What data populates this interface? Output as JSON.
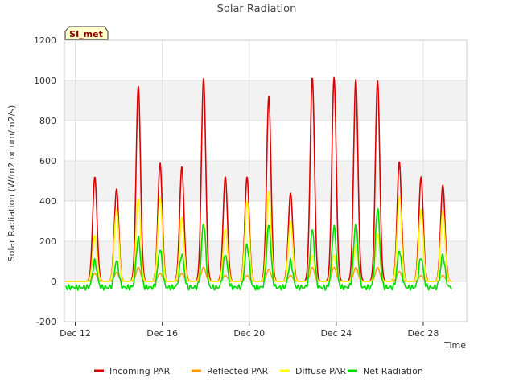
{
  "chart_data": {
    "type": "line",
    "title": "Solar Radiation",
    "xlabel": "Time",
    "ylabel": "Solar Radiation (W/m2 or um/m2/s)",
    "site_badge": "SI_met",
    "xlim": [
      0,
      18
    ],
    "ylim": [
      -200,
      1200
    ],
    "y_ticks": [
      -200,
      0,
      200,
      400,
      600,
      800,
      1000,
      1200
    ],
    "x_ticks": [
      {
        "value": 0,
        "label": "Dec 12"
      },
      {
        "value": 4,
        "label": "Dec 16"
      },
      {
        "value": 8,
        "label": "Dec 20"
      },
      {
        "value": 12,
        "label": "Dec 24"
      },
      {
        "value": 16,
        "label": "Dec 28"
      }
    ],
    "grid": true,
    "banded_background": true,
    "legend_position": "bottom",
    "series": [
      {
        "name": "Incoming PAR",
        "color": "#dd0000"
      },
      {
        "name": "Reflected PAR",
        "color": "#ff9900"
      },
      {
        "name": "Diffuse PAR",
        "color": "#ffff00"
      },
      {
        "name": "Net Radiation",
        "color": "#00dd00"
      }
    ],
    "daily_peaks": [
      {
        "day_center": 0.9,
        "incoming": 520,
        "reflected": 40,
        "diffuse": 230,
        "net": 100
      },
      {
        "day_center": 1.9,
        "incoming": 460,
        "reflected": 45,
        "diffuse": 360,
        "net": 100
      },
      {
        "day_center": 2.9,
        "incoming": 970,
        "reflected": 70,
        "diffuse": 410,
        "net": 215
      },
      {
        "day_center": 3.9,
        "incoming": 590,
        "reflected": 40,
        "diffuse": 420,
        "net": 160
      },
      {
        "day_center": 4.9,
        "incoming": 570,
        "reflected": 40,
        "diffuse": 320,
        "net": 135
      },
      {
        "day_center": 5.9,
        "incoming": 1010,
        "reflected": 70,
        "diffuse": 290,
        "net": 290
      },
      {
        "day_center": 6.9,
        "incoming": 520,
        "reflected": 30,
        "diffuse": 260,
        "net": 135
      },
      {
        "day_center": 7.9,
        "incoming": 520,
        "reflected": 30,
        "diffuse": 400,
        "net": 180
      },
      {
        "day_center": 8.9,
        "incoming": 920,
        "reflected": 60,
        "diffuse": 450,
        "net": 280
      },
      {
        "day_center": 9.9,
        "incoming": 440,
        "reflected": 30,
        "diffuse": 300,
        "net": 100
      },
      {
        "day_center": 10.9,
        "incoming": 1015,
        "reflected": 70,
        "diffuse": 130,
        "net": 255
      },
      {
        "day_center": 11.9,
        "incoming": 1015,
        "reflected": 70,
        "diffuse": 130,
        "net": 270
      },
      {
        "day_center": 12.9,
        "incoming": 1005,
        "reflected": 70,
        "diffuse": 180,
        "net": 290
      },
      {
        "day_center": 13.9,
        "incoming": 1000,
        "reflected": 70,
        "diffuse": 240,
        "net": 365
      },
      {
        "day_center": 14.9,
        "incoming": 595,
        "reflected": 50,
        "diffuse": 420,
        "net": 155
      },
      {
        "day_center": 15.9,
        "incoming": 520,
        "reflected": 30,
        "diffuse": 360,
        "net": 120
      },
      {
        "day_center": 16.9,
        "incoming": 480,
        "reflected": 30,
        "diffuse": 350,
        "net": 130
      }
    ]
  }
}
